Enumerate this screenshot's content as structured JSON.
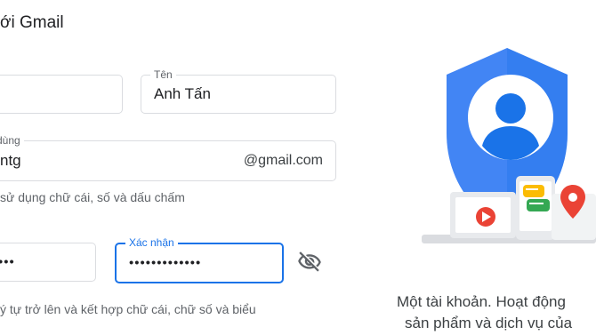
{
  "header": {
    "title": "ới Gmail"
  },
  "form": {
    "ho": {
      "value": ""
    },
    "ten": {
      "label": "Tên",
      "value": "Anh Tấn"
    },
    "username": {
      "label": "dùng",
      "value": "ntg",
      "suffix": "@gmail.com",
      "hint": "sử dụng chữ cái, số và dấu chấm"
    },
    "password": {
      "value": "•••"
    },
    "confirm": {
      "label": "Xác nhận",
      "value": "•••••••••••••"
    },
    "password_hint": "ý tự trở lên và kết hợp chữ cái, chữ số và biểu"
  },
  "illustration": {
    "caption_line1": "Một tài khoản. Hoạt động",
    "caption_line2": "sản phẩm và dịch vụ của",
    "colors": {
      "shield": "#4285f4",
      "shield_dark": "#1a73e8",
      "red": "#ea4335",
      "yellow": "#fbbc04",
      "green": "#34a853",
      "device": "#e8eaed"
    }
  },
  "icons": {
    "show_password": "eye-off-icon",
    "account": "account-circle-icon",
    "play": "play-icon",
    "map_pin": "map-pin-icon"
  }
}
